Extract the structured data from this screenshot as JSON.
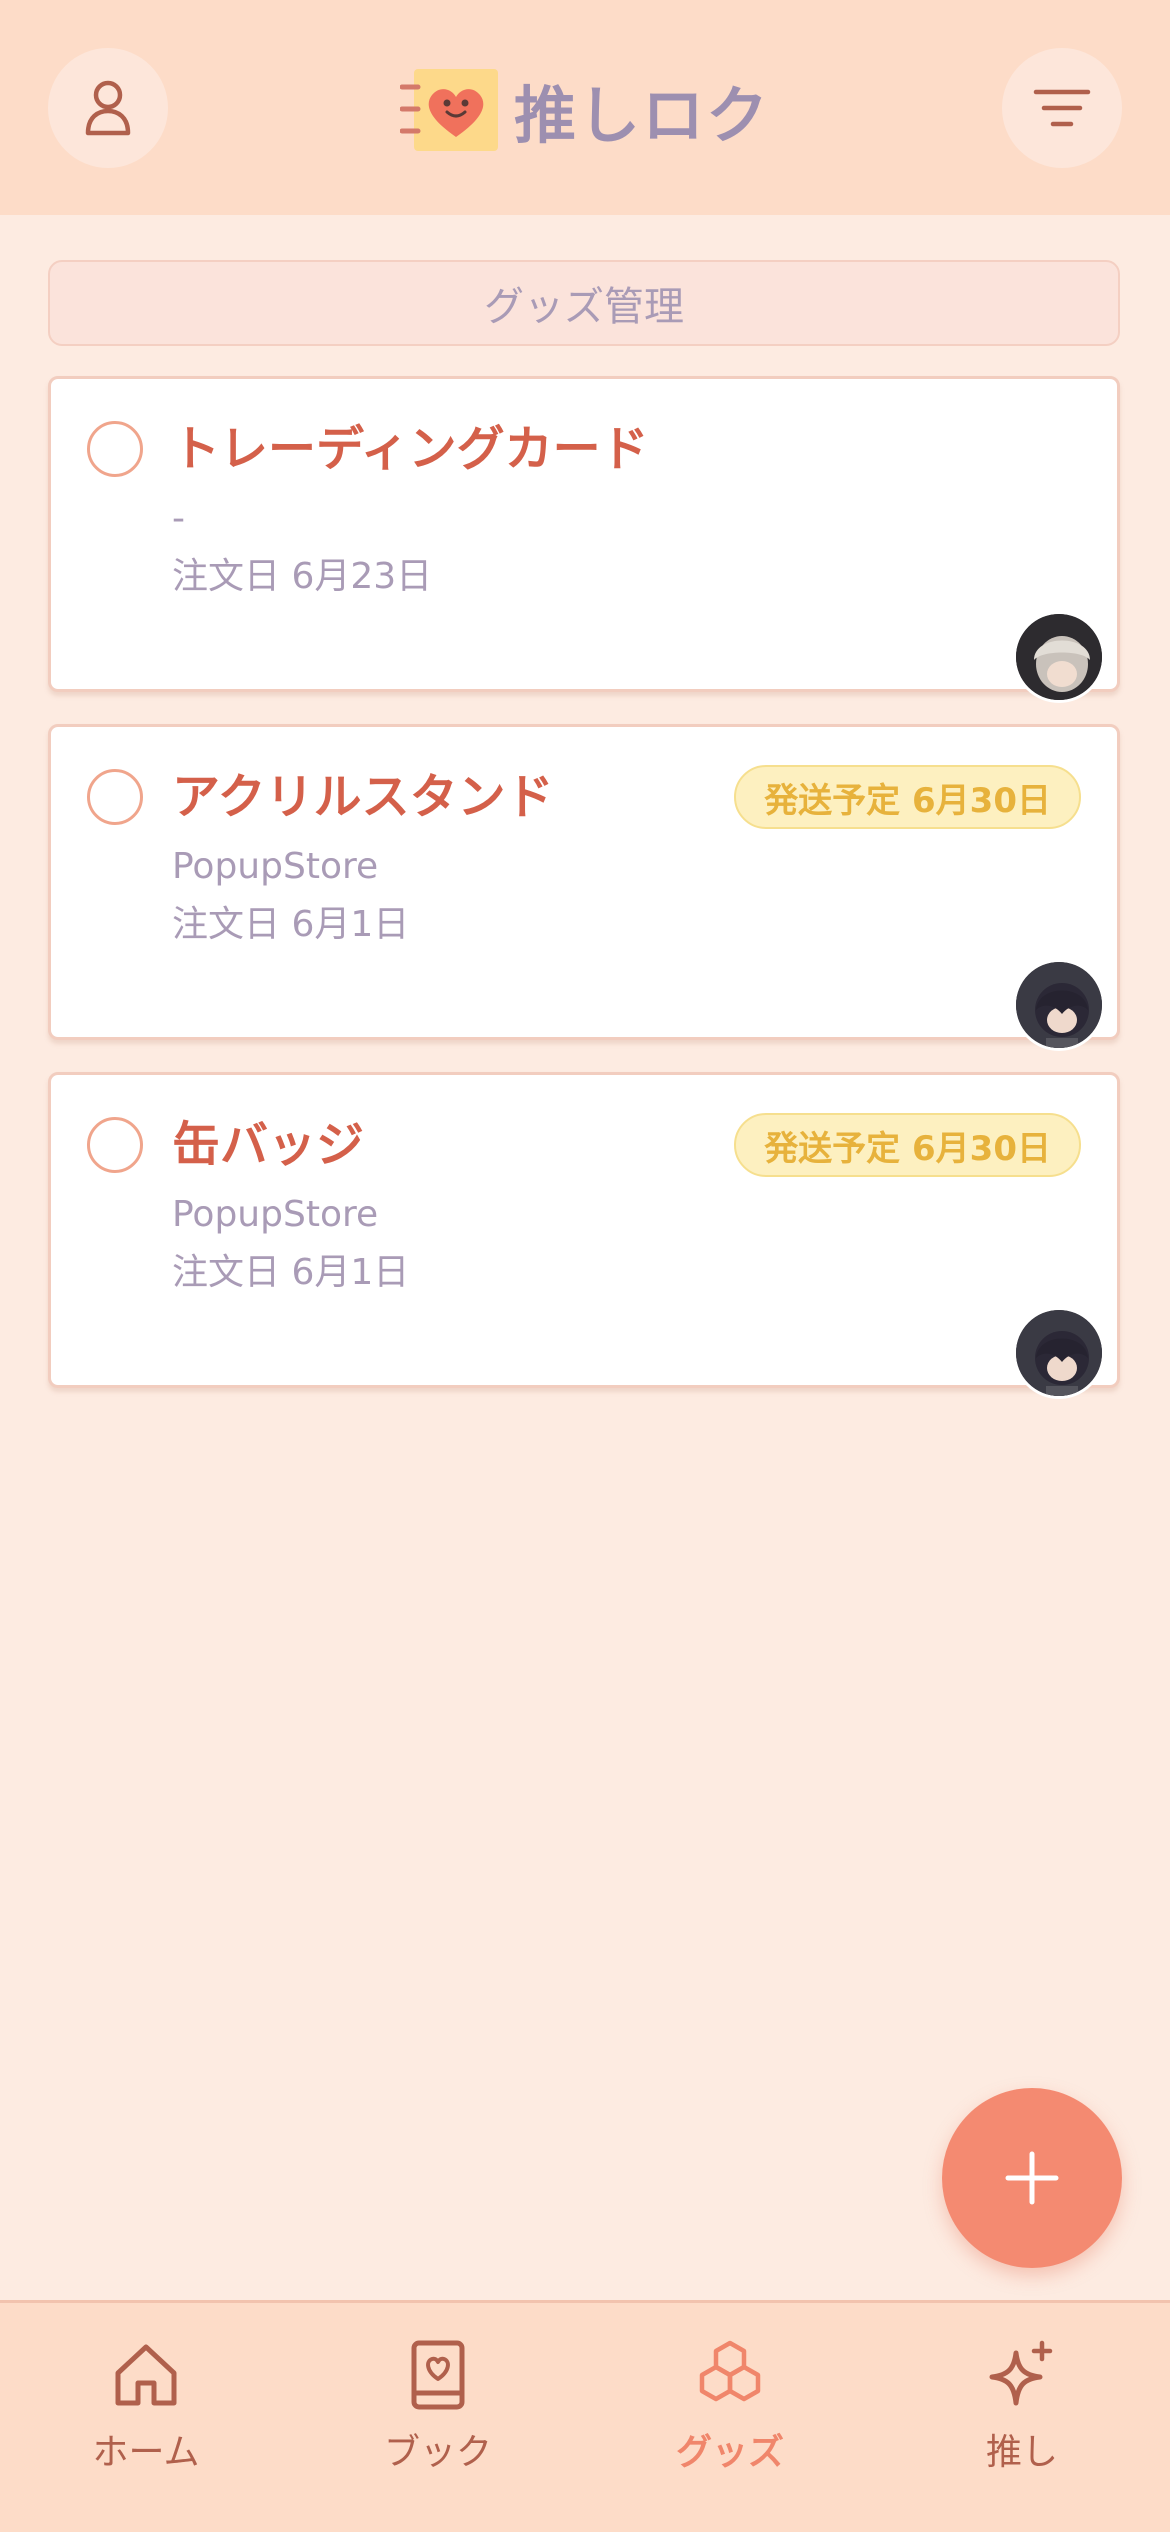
{
  "header": {
    "app_name": "推しロク",
    "profile_icon": "person-icon",
    "filter_icon": "filter-icon"
  },
  "section": {
    "title": "グッズ管理"
  },
  "items": [
    {
      "title": "トレーディングカード",
      "shop": "-",
      "order_date": "注文日 6月23日",
      "badge": ""
    },
    {
      "title": "アクリルスタンド",
      "shop": "PopupStore",
      "order_date": "注文日 6月1日",
      "badge": "発送予定 6月30日"
    },
    {
      "title": "缶バッジ",
      "shop": "PopupStore",
      "order_date": "注文日 6月1日",
      "badge": "発送予定 6月30日"
    }
  ],
  "fab": {
    "icon": "plus-icon"
  },
  "tabbar": {
    "tabs": [
      {
        "label": "ホーム",
        "icon": "home-icon",
        "active": false
      },
      {
        "label": "ブック",
        "icon": "book-icon",
        "active": false
      },
      {
        "label": "グッズ",
        "icon": "cubes-icon",
        "active": true
      },
      {
        "label": "推し",
        "icon": "sparkle-icon",
        "active": false
      }
    ]
  },
  "colors": {
    "accent": "#f48a71",
    "title": "#d4604a",
    "muted": "#a99bb6",
    "badge_bg": "#fdf0c0",
    "badge_text": "#e7b23c"
  }
}
